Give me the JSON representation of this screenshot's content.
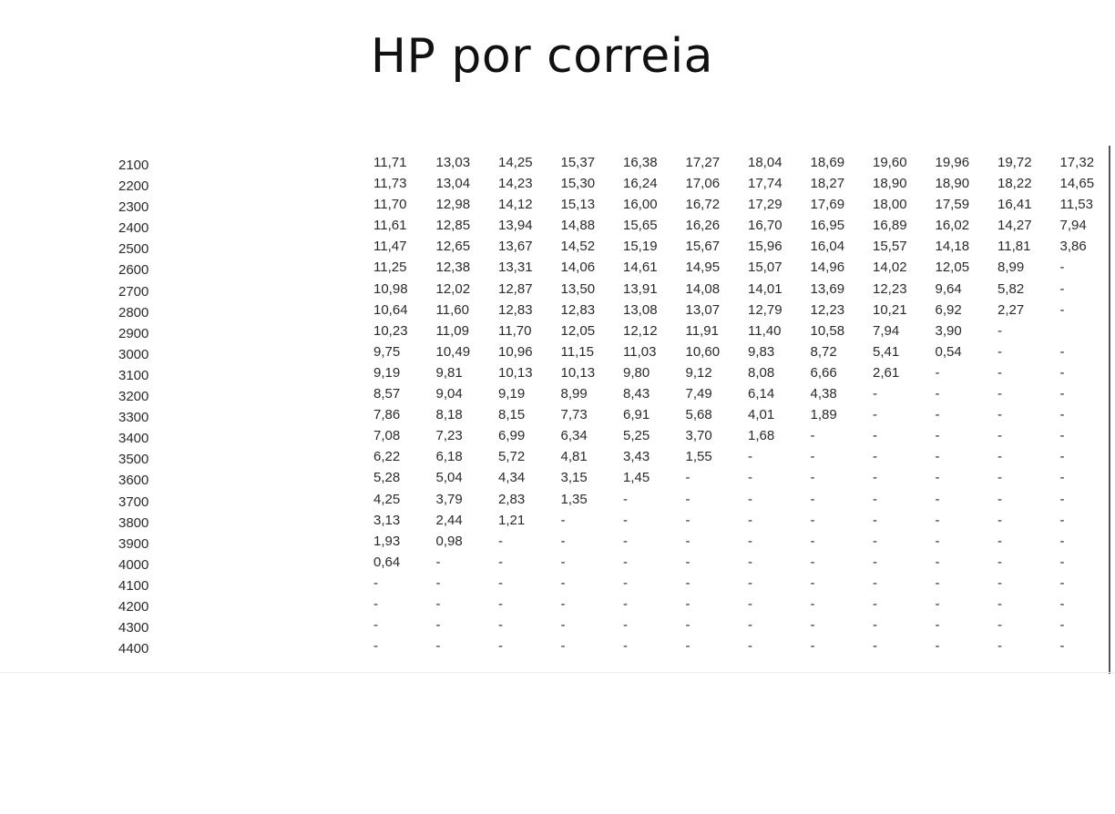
{
  "title": "HP por correia",
  "table": {
    "rpm": [
      "2100",
      "2200",
      "2300",
      "2400",
      "2500",
      "2600",
      "2700",
      "2800",
      "2900",
      "3000",
      "3100",
      "3200",
      "3300",
      "3400",
      "3500",
      "3600",
      "3700",
      "3800",
      "3900",
      "4000",
      "4100",
      "4200",
      "4300",
      "4400"
    ],
    "rows": [
      [
        "11,71",
        "13,03",
        "14,25",
        "15,37",
        "16,38",
        "17,27",
        "18,04",
        "18,69",
        "19,60",
        "19,96",
        "19,72",
        "17,32"
      ],
      [
        "11,73",
        "13,04",
        "14,23",
        "15,30",
        "16,24",
        "17,06",
        "17,74",
        "18,27",
        "18,90",
        "18,90",
        "18,22",
        "14,65"
      ],
      [
        "11,70",
        "12,98",
        "14,12",
        "15,13",
        "16,00",
        "16,72",
        "17,29",
        "17,69",
        "18,00",
        "17,59",
        "16,41",
        "11,53"
      ],
      [
        "11,61",
        "12,85",
        "13,94",
        "14,88",
        "15,65",
        "16,26",
        "16,70",
        "16,95",
        "16,89",
        "16,02",
        "14,27",
        "7,94"
      ],
      [
        "11,47",
        "12,65",
        "13,67",
        "14,52",
        "15,19",
        "15,67",
        "15,96",
        "16,04",
        "15,57",
        "14,18",
        "11,81",
        "3,86"
      ],
      [
        "11,25",
        "12,38",
        "13,31",
        "14,06",
        "14,61",
        "14,95",
        "15,07",
        "14,96",
        "14,02",
        "12,05",
        "8,99",
        "-"
      ],
      [
        "10,98",
        "12,02",
        "12,87",
        "13,50",
        "13,91",
        "14,08",
        "14,01",
        "13,69",
        "12,23",
        "9,64",
        "5,82",
        "-"
      ],
      [
        "10,64",
        "11,60",
        "12,83",
        "12,83",
        "13,08",
        "13,07",
        "12,79",
        "12,23",
        "10,21",
        "6,92",
        "2,27",
        "-"
      ],
      [
        "10,23",
        "11,09",
        "11,70",
        "12,05",
        "12,12",
        "11,91",
        "11,40",
        "10,58",
        "7,94",
        "3,90",
        "-",
        ""
      ],
      [
        "9,75",
        "10,49",
        "10,96",
        "11,15",
        "11,03",
        "10,60",
        "9,83",
        "8,72",
        "5,41",
        "0,54",
        "-",
        "-"
      ],
      [
        "9,19",
        "9,81",
        "10,13",
        "10,13",
        "9,80",
        "9,12",
        "8,08",
        "6,66",
        "2,61",
        "-",
        "-",
        "-"
      ],
      [
        "8,57",
        "9,04",
        "9,19",
        "8,99",
        "8,43",
        "7,49",
        "6,14",
        "4,38",
        "-",
        "-",
        "-",
        "-"
      ],
      [
        "7,86",
        "8,18",
        "8,15",
        "7,73",
        "6,91",
        "5,68",
        "4,01",
        "1,89",
        "-",
        "-",
        "-",
        "-"
      ],
      [
        "7,08",
        "7,23",
        "6,99",
        "6,34",
        "5,25",
        "3,70",
        "1,68",
        "-",
        "-",
        "-",
        "-",
        "-"
      ],
      [
        "6,22",
        "6,18",
        "5,72",
        "4,81",
        "3,43",
        "1,55",
        "-",
        "-",
        "-",
        "-",
        "-",
        "-"
      ],
      [
        "5,28",
        "5,04",
        "4,34",
        "3,15",
        "1,45",
        "-",
        "-",
        "-",
        "-",
        "-",
        "-",
        "-"
      ],
      [
        "4,25",
        "3,79",
        "2,83",
        "1,35",
        "-",
        "-",
        "-",
        "-",
        "-",
        "-",
        "-",
        "-"
      ],
      [
        "3,13",
        "2,44",
        "1,21",
        "-",
        "-",
        "-",
        "-",
        "-",
        "-",
        "-",
        "-",
        "-"
      ],
      [
        "1,93",
        "0,98",
        "-",
        "-",
        "-",
        "-",
        "-",
        "-",
        "-",
        "-",
        "-",
        "-"
      ],
      [
        "0,64",
        "-",
        "-",
        "-",
        "-",
        "-",
        "-",
        "-",
        "-",
        "-",
        "-",
        "-"
      ],
      [
        "-",
        "-",
        "-",
        "-",
        "-",
        "-",
        "-",
        "-",
        "-",
        "-",
        "-",
        "-"
      ],
      [
        "-",
        "-",
        "-",
        "-",
        "-",
        "-",
        "-",
        "-",
        "-",
        "-",
        "-",
        "-"
      ],
      [
        "-",
        "-",
        "-",
        "-",
        "-",
        "-",
        "-",
        "-",
        "-",
        "-",
        "-",
        "-"
      ],
      [
        "-",
        "-",
        "-",
        "-",
        "-",
        "-",
        "-",
        "-",
        "-",
        "-",
        "-",
        "-"
      ]
    ]
  }
}
